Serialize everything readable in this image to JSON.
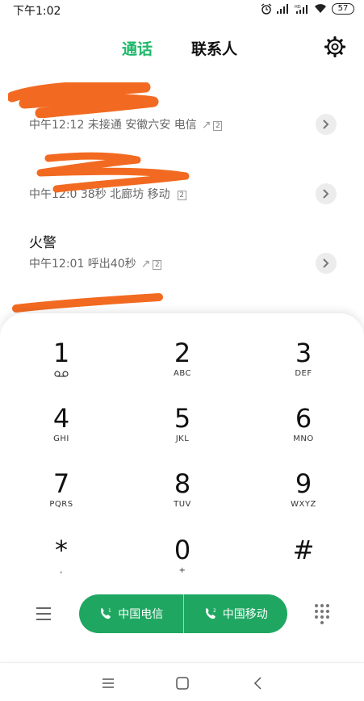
{
  "status": {
    "time": "下午1:02",
    "battery": "57"
  },
  "tabs": {
    "calls": "通话",
    "contacts": "联系人"
  },
  "calls": [
    {
      "name": "",
      "detail": "中午12:12 未接通 安徽六安 电信",
      "direction": "↗",
      "sim": "2"
    },
    {
      "name": "",
      "detail": "中午12:0 38秒 北廊坊 移动",
      "direction": "",
      "sim": "2"
    },
    {
      "name": "火警",
      "detail": "中午12:01 呼出40秒",
      "direction": "↗",
      "sim": "2"
    },
    {
      "name": "",
      "detail": "",
      "direction": "",
      "sim": ""
    }
  ],
  "keys": [
    {
      "digit": "1",
      "letters": ""
    },
    {
      "digit": "2",
      "letters": "ABC"
    },
    {
      "digit": "3",
      "letters": "DEF"
    },
    {
      "digit": "4",
      "letters": "GHI"
    },
    {
      "digit": "5",
      "letters": "JKL"
    },
    {
      "digit": "6",
      "letters": "MNO"
    },
    {
      "digit": "7",
      "letters": "PQRS"
    },
    {
      "digit": "8",
      "letters": "TUV"
    },
    {
      "digit": "9",
      "letters": "WXYZ"
    },
    {
      "digit": "*",
      "letters": ","
    },
    {
      "digit": "0",
      "letters": "+"
    },
    {
      "digit": "#",
      "letters": ""
    }
  ],
  "sim_buttons": [
    {
      "label": "中国电信",
      "sim": "1"
    },
    {
      "label": "中国移动",
      "sim": "2"
    }
  ],
  "colors": {
    "accent": "#1db86a",
    "call_button": "#1fa762",
    "redaction": "#f26a21"
  },
  "icons": [
    "alarm-icon",
    "signal-icon",
    "wifi-icon",
    "battery-icon",
    "settings-gear-icon",
    "chevron-right-icon",
    "voicemail-icon",
    "menu-icon",
    "phone-icon",
    "dialpad-icon",
    "recent-apps-icon",
    "home-icon",
    "back-icon"
  ]
}
